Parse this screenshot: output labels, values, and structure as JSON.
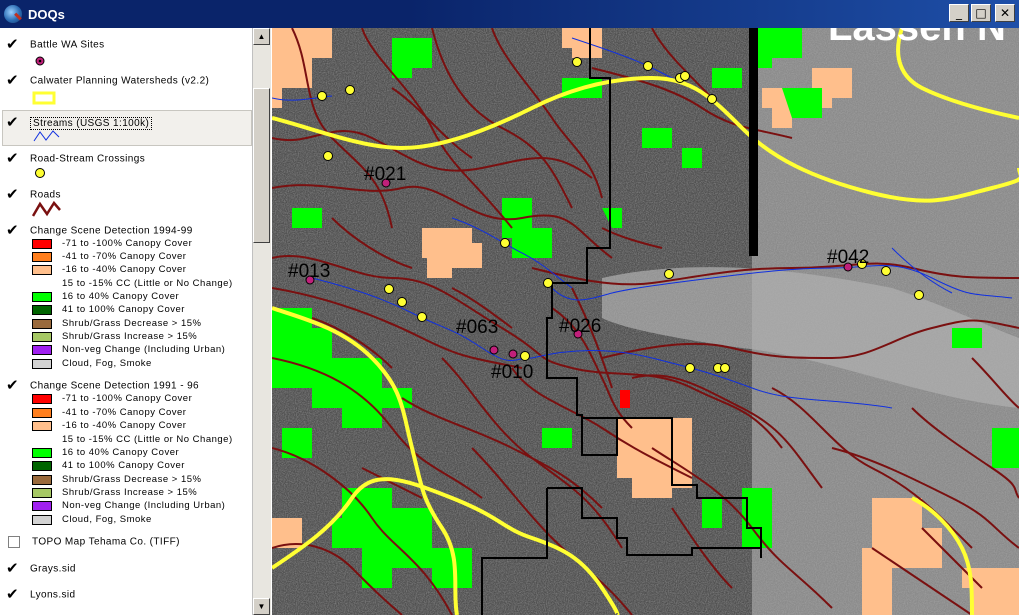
{
  "window": {
    "title": "DOQs",
    "buttons": {
      "minimize": "_",
      "maximize": "□",
      "close": "✕"
    }
  },
  "toc": {
    "layers": [
      {
        "name": "Battle WA Sites",
        "checked": true
      },
      {
        "name": "Calwater Planning Watersheds (v2.2)",
        "checked": true
      },
      {
        "name": "Streams (USGS 1:100k)",
        "checked": true
      },
      {
        "name": "Road-Stream Crossings",
        "checked": true
      },
      {
        "name": "Roads",
        "checked": true
      },
      {
        "name": "Change Scene Detection 1994-99",
        "checked": true
      },
      {
        "name": "Change Scene Detection 1991 - 96",
        "checked": true
      },
      {
        "name": "TOPO Map Tehama Co. (TIFF)",
        "checked": false
      },
      {
        "name": "Grays.sid",
        "checked": true
      },
      {
        "name": "Lyons.sid",
        "checked": true
      }
    ],
    "legend_1994": [
      {
        "label": "-71 to -100% Canopy Cover",
        "color": "#ff0000"
      },
      {
        "label": "-41 to -70% Canopy Cover",
        "color": "#ff7f1e"
      },
      {
        "label": "-16 to -40% Canopy Cover",
        "color": "#ffbf8c"
      },
      {
        "label": "15 to -15% CC (Little or No Change)",
        "color": ""
      },
      {
        "label": "16 to 40% Canopy Cover",
        "color": "#00ff00"
      },
      {
        "label": "41 to 100% Canopy Cover",
        "color": "#006400"
      },
      {
        "label": "Shrub/Grass Decrease > 15%",
        "color": "#9a6a3c"
      },
      {
        "label": "Shrub/Grass Increase > 15%",
        "color": "#a6c864"
      },
      {
        "label": "Non-veg Change (Including Urban)",
        "color": "#a020f0"
      },
      {
        "label": "Cloud, Fog, Smoke",
        "color": "#d3d3d3"
      }
    ],
    "legend_1991": [
      {
        "label": "-71 to -100% Canopy Cover",
        "color": "#ff0000"
      },
      {
        "label": "-41 to -70% Canopy Cover",
        "color": "#ff7f1e"
      },
      {
        "label": "-16 to -40% Canopy Cover",
        "color": "#ffbf8c"
      },
      {
        "label": "15 to -15% CC (Little or No Change)",
        "color": ""
      },
      {
        "label": "16 to 40% Canopy Cover",
        "color": "#00ff00"
      },
      {
        "label": "41 to 100% Canopy Cover",
        "color": "#006400"
      },
      {
        "label": "Shrub/Grass Decrease > 15%",
        "color": "#9a6a3c"
      },
      {
        "label": "Shrub/Grass Increase > 15%",
        "color": "#a6c864"
      },
      {
        "label": "Non-veg Change (Including Urban)",
        "color": "#a020f0"
      },
      {
        "label": "Cloud, Fog, Smoke",
        "color": "#d3d3d3"
      }
    ]
  },
  "map": {
    "banner": "Lassen N",
    "sites": [
      "#021",
      "#013",
      "#063",
      "#026",
      "#010",
      "#042"
    ],
    "colors": {
      "roads": "#7a1010",
      "watershed": "#ffff33",
      "streams": "#1030e0",
      "crossing": "#ffff33",
      "site": "#c0207a",
      "boundary": "#000000"
    }
  }
}
